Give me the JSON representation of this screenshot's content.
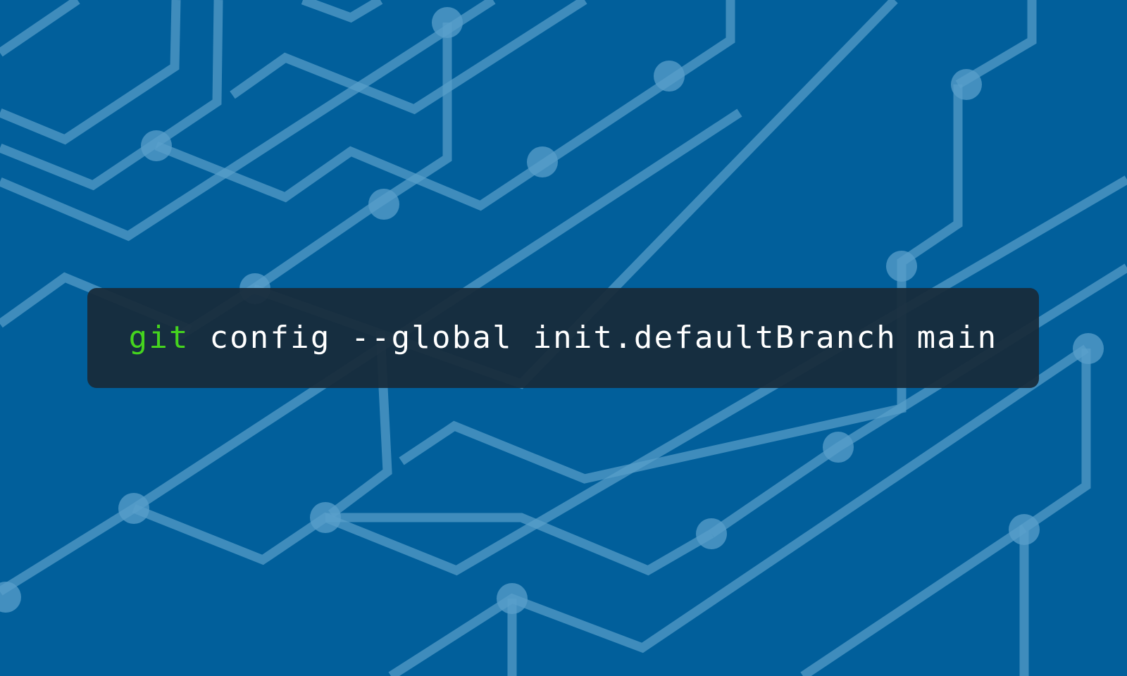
{
  "command": {
    "keyword": "git",
    "rest": " config --global init.defaultBranch main"
  },
  "colors": {
    "background": "#015f9b",
    "panel": "#182a39",
    "keyword": "#45d41e",
    "text": "#ffffff",
    "circuit": "#6fa9cf"
  }
}
